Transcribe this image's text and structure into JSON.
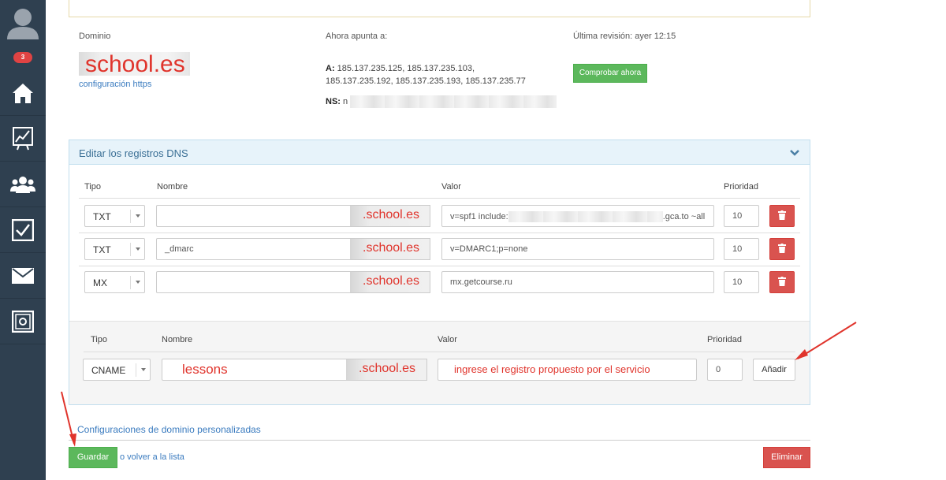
{
  "sidebar": {
    "notification_count": "3",
    "items": [
      {
        "icon": "home-icon"
      },
      {
        "icon": "chart-icon"
      },
      {
        "icon": "users-icon"
      },
      {
        "icon": "tasks-icon"
      },
      {
        "icon": "mail-icon"
      },
      {
        "icon": "safe-icon"
      }
    ]
  },
  "domain": {
    "label": "Dominio",
    "name": "school.es",
    "https_link": "configuración https",
    "points_label": "Ahora apunta a:",
    "a_label": "A:",
    "a_records": "185.137.235.125, 185.137.235.103, 185.137.235.192, 185.137.235.193, 185.137.235.77",
    "ns_label": "NS:",
    "ns_value": "n",
    "last_check": "Última revisión: ayer 12:15",
    "check_button": "Comprobar ahora"
  },
  "dns": {
    "title": "Editar los registros DNS",
    "headers": {
      "tipo": "Tipo",
      "nombre": "Nombre",
      "valor": "Valor",
      "prioridad": "Prioridad"
    },
    "records": [
      {
        "tipo": "TXT",
        "nombre": "",
        "suffix": ".school.es",
        "valor_start": "v=spf1 include:",
        "valor_end": ".gca.to ~all",
        "prioridad": "10"
      },
      {
        "tipo": "TXT",
        "nombre": "_dmarc",
        "suffix": ".school.es",
        "valor": "v=DMARC1;p=none",
        "prioridad": "10"
      },
      {
        "tipo": "MX",
        "nombre": "",
        "suffix": ".school.es",
        "valor": "mx.getcourse.ru",
        "prioridad": "10"
      }
    ],
    "new_record": {
      "headers": {
        "tipo": "Tipo",
        "nombre": "Nombre",
        "valor": "Valor",
        "prioridad": "Prioridad"
      },
      "tipo": "CNAME",
      "nombre": "lessons",
      "suffix": ".school.es",
      "valor": "ingrese el registro propuesto por el servicio",
      "prioridad": "0",
      "add_button": "Añadir"
    }
  },
  "footer": {
    "custom_link": "Configuraciones de dominio personalizadas",
    "save_button": "Guardar",
    "back_link": "o volver a la lista",
    "delete_button": "Eliminar"
  },
  "colors": {
    "sidebar": "#2f4050",
    "accent_green": "#5cb85c",
    "danger_red": "#d9534f",
    "annotation_red": "#e0342c",
    "link_blue": "#3a7bbf"
  }
}
